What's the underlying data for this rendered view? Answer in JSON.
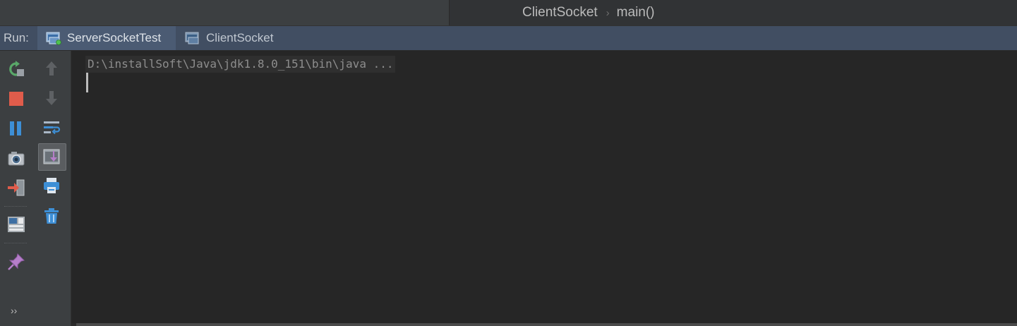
{
  "breadcrumb": {
    "class_name": "ClientSocket",
    "separator": "›",
    "method_name": "main()"
  },
  "run_panel": {
    "label": "Run:",
    "tabs": [
      {
        "label": "ServerSocketTest",
        "active": true
      },
      {
        "label": "ClientSocket",
        "active": false
      }
    ]
  },
  "toolbar_left": {
    "expand_glyph": "››",
    "buttons": [
      "rerun-icon",
      "stop-icon",
      "pause-icon",
      "camera-icon",
      "exit-icon",
      "layout-icon",
      "pin-icon"
    ]
  },
  "toolbar_right": {
    "buttons": [
      "arrow-up-icon",
      "arrow-down-icon",
      "soft-wrap-icon",
      "scroll-to-end-icon",
      "print-icon",
      "trash-icon"
    ]
  },
  "console": {
    "command_line": "D:\\installSoft\\Java\\jdk1.8.0_151\\bin\\java ..."
  },
  "colors": {
    "tab_bar": "#414e62",
    "active_tab": "#4b5b73",
    "console_bg": "#262626",
    "stop_red": "#e05c4b",
    "rerun_green": "#59a869",
    "pause_blue": "#3d8fd6"
  }
}
